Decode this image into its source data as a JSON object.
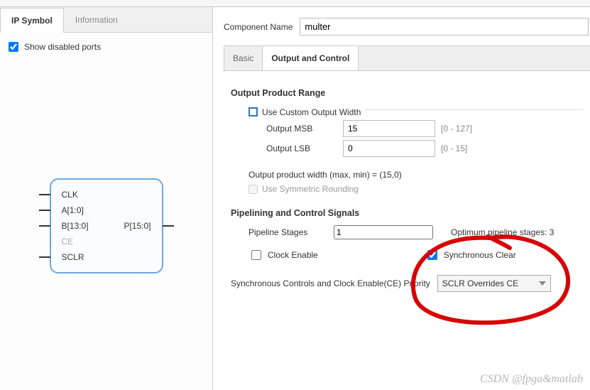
{
  "left": {
    "tabs": {
      "symbol": "IP Symbol",
      "info": "Information"
    },
    "show_disabled": "Show disabled ports",
    "ports": {
      "clk": "CLK",
      "a": "A[1:0]",
      "b": "B[13:0]",
      "ce": "CE",
      "sclr": "SCLR",
      "p": "P[15:0]"
    }
  },
  "right": {
    "comp_name_label": "Component Name",
    "comp_name_value": "multer",
    "tabs": {
      "basic": "Basic",
      "output": "Output and Control"
    },
    "sections": {
      "output_range": "Output Product Range",
      "pipelining": "Pipelining and Control Signals"
    },
    "use_custom": "Use Custom Output Width",
    "msb_label": "Output MSB",
    "msb_value": "15",
    "msb_range": "[0 - 127]",
    "lsb_label": "Output LSB",
    "lsb_value": "0",
    "lsb_range": "[0 - 15]",
    "output_width_info": "Output product width (max, min) = (15,0)",
    "use_symm": "Use Symmetric Rounding",
    "pipeline_stages_label": "Pipeline Stages",
    "pipeline_stages_value": "1",
    "optimum": "Optimum pipeline stages: 3",
    "clock_enable": "Clock Enable",
    "sync_clear": "Synchronous Clear",
    "sync_ctrl_label": "Synchronous Controls and Clock Enable(CE) Priority",
    "sync_ctrl_value": "SCLR Overrides CE"
  },
  "watermark": "CSDN @fpga&matlab"
}
